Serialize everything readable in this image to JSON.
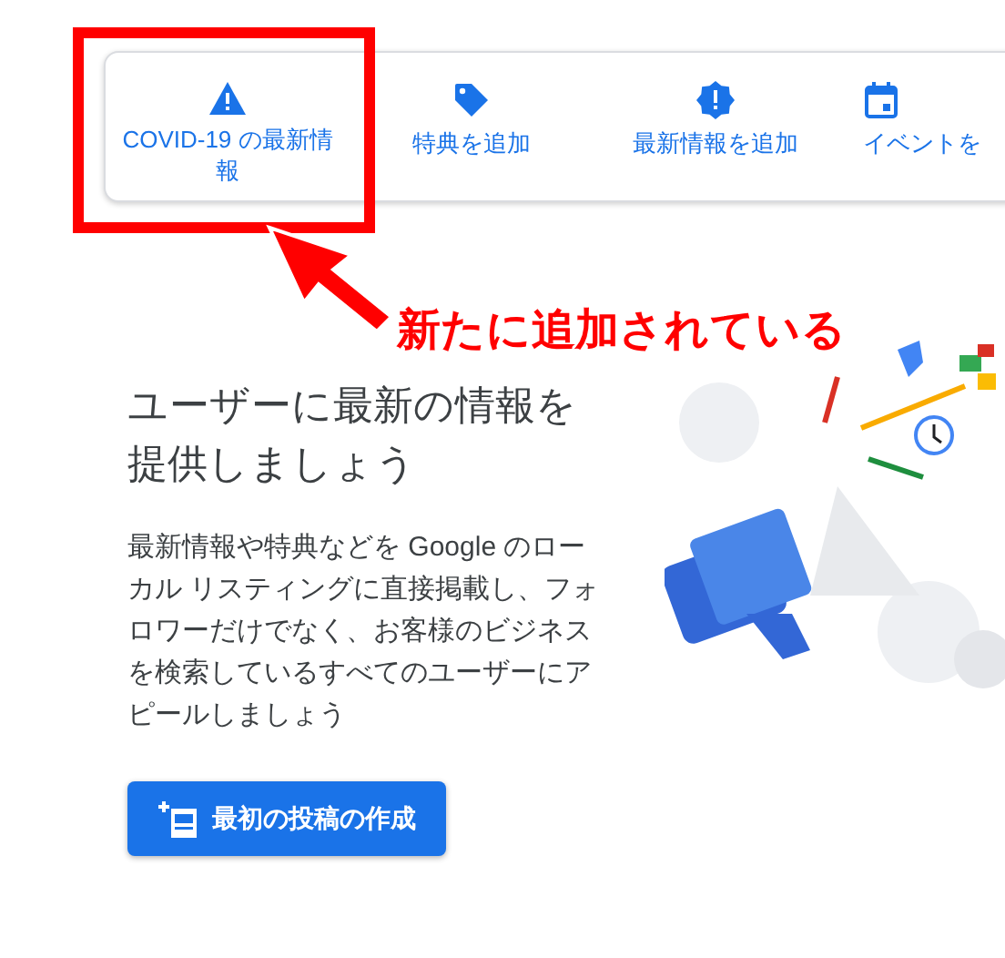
{
  "tabs": [
    {
      "label": "COVID-19 の最新情報"
    },
    {
      "label": "特典を追加"
    },
    {
      "label": "最新情報を追加"
    },
    {
      "label": "イベントを"
    }
  ],
  "annotation": {
    "text": "新たに追加されている"
  },
  "heading": "ユーザーに最新の情報を提供しましょう",
  "description": "最新情報や特典などを Google のローカル リスティングに直接掲載し、フォロワーだけでなく、お客様のビジネスを検索しているすべてのユーザーにアピールしましょう",
  "create_button": {
    "label": "最初の投稿の作成"
  }
}
